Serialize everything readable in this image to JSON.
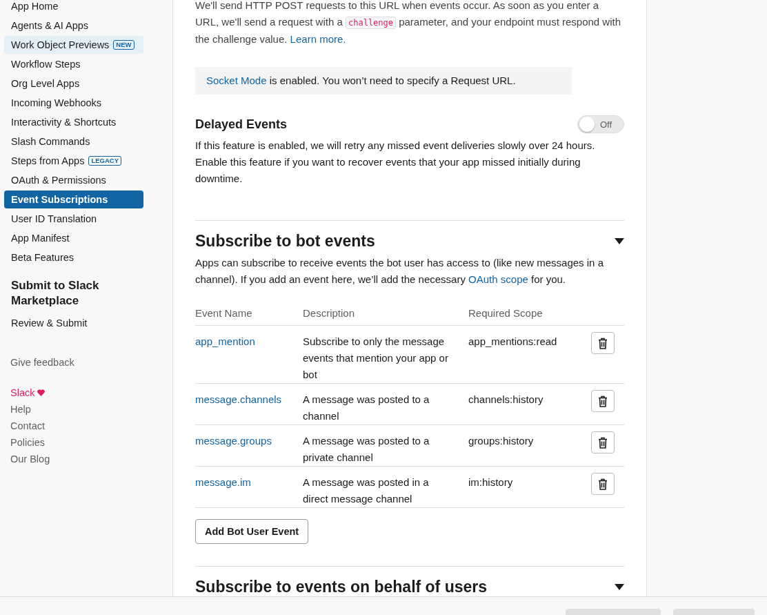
{
  "sidebar": {
    "items": [
      {
        "label": "App Home",
        "selected": false,
        "highlighted": false
      },
      {
        "label": "Agents & AI Apps",
        "selected": false,
        "highlighted": false
      },
      {
        "label": "Work Object Previews",
        "selected": false,
        "highlighted": true,
        "badge": "NEW"
      },
      {
        "label": "Workflow Steps",
        "selected": false,
        "highlighted": false
      },
      {
        "label": "Org Level Apps",
        "selected": false,
        "highlighted": false
      },
      {
        "label": "Incoming Webhooks",
        "selected": false,
        "highlighted": false
      },
      {
        "label": "Interactivity & Shortcuts",
        "selected": false,
        "highlighted": false
      },
      {
        "label": "Slash Commands",
        "selected": false,
        "highlighted": false
      },
      {
        "label": "Steps from Apps",
        "selected": false,
        "highlighted": false,
        "badge": "LEGACY"
      },
      {
        "label": "OAuth & Permissions",
        "selected": false,
        "highlighted": false
      },
      {
        "label": "Event Subscriptions",
        "selected": true,
        "highlighted": false
      },
      {
        "label": "User ID Translation",
        "selected": false,
        "highlighted": false
      },
      {
        "label": "App Manifest",
        "selected": false,
        "highlighted": false
      },
      {
        "label": "Beta Features",
        "selected": false,
        "highlighted": false
      }
    ],
    "section_title": "Submit to Slack Marketplace",
    "section_items": [
      {
        "label": "Review & Submit",
        "selected": false,
        "highlighted": false
      }
    ],
    "feedback": "Give feedback",
    "footer_links": [
      {
        "label": "Slack",
        "kind": "brand"
      },
      {
        "label": "Help",
        "kind": "plain"
      },
      {
        "label": "Contact",
        "kind": "plain"
      },
      {
        "label": "Policies",
        "kind": "plain"
      },
      {
        "label": "Our Blog",
        "kind": "plain"
      }
    ]
  },
  "intro": {
    "line_1": "We'll send HTTP POST requests to this URL when events occur. As soon as you enter a URL, we'll",
    "before_code": "send a request with a",
    "code": "challenge",
    "after_code": "parameter, and your endpoint must respond with the challenge value.",
    "link": "Learn more."
  },
  "notice": {
    "link": "Socket Mode",
    "text": "is enabled. You won’t need to specify a Request URL."
  },
  "delayed_events": {
    "title": "Delayed Events",
    "toggle": {
      "on": false,
      "label": "Off"
    },
    "description": "If this feature is enabled, we will retry any missed event deliveries slowly over 24 hours. Enable this feature if you want to recover events that your app missed initially during downtime."
  },
  "bot_events": {
    "title": "Subscribe to bot events",
    "expanded": true,
    "description": "Apps can subscribe to receive events the bot user has access to (like new messages in a channel). If you add an event here, we’ll add the necessary",
    "link": "OAuth scope",
    "description_end": "for you.",
    "table": {
      "columns": [
        "Event Name",
        "Description",
        "Required Scope"
      ],
      "rows": [
        {
          "event": "app_mention",
          "description": "Subscribe to only the message events that mention your app or bot",
          "scope": "app_mentions:read"
        },
        {
          "event": "message.channels",
          "description": "A message was posted to a channel",
          "scope": "channels:history"
        },
        {
          "event": "message.groups",
          "description": "A message was posted to a private channel",
          "scope": "groups:history"
        },
        {
          "event": "message.im",
          "description": "A message was posted in a direct message channel",
          "scope": "im:history"
        }
      ]
    },
    "add_button": "Add Bot User Event"
  },
  "user_events": {
    "title": "Subscribe to events on behalf of users",
    "expanded": true
  },
  "bottom_bar": {
    "buttons": [
      {
        "disabled": true
      },
      {
        "disabled": true
      }
    ]
  }
}
